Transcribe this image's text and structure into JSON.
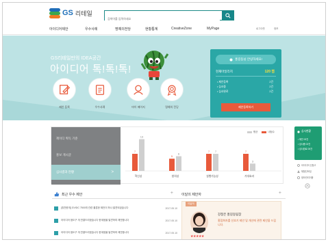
{
  "header": {
    "logo_gs": "GS",
    "logo_text": "리테일",
    "search_placeholder": "검색어를 입력하세요",
    "nav": [
      "아이디어제안",
      "우수사례",
      "명예의전당",
      "현황통계",
      "CreativeZone",
      "MyPage"
    ],
    "util": [
      "로그아웃",
      "정보"
    ]
  },
  "hero": {
    "subtitle": "GS리테일만의 IDEA공간",
    "title": "아이디어 톡!톡!톡!",
    "quick": [
      {
        "label": "제안 등록",
        "icon": "pencil-icon"
      },
      {
        "label": "우수사례",
        "icon": "document-icon"
      },
      {
        "label": "마이 페이지",
        "icon": "person-icon"
      },
      {
        "label": "명예의 전당",
        "icon": "medal-icon"
      }
    ]
  },
  "user_card": {
    "greeting": "홍길동님 안녕하세요!",
    "points_label": "현재마일리지",
    "points_value": "120 점",
    "stats": [
      {
        "label": "• 제안등록",
        "value": "2건"
      },
      {
        "label": "• 심사중",
        "value": "2건"
      },
      {
        "label": "• 심사완료",
        "value": "2건"
      }
    ],
    "button": "제안등록하기"
  },
  "status": {
    "tabs": [
      "제이디 획득 기준",
      "홍보 게시글",
      "심사결과 현황"
    ],
    "active_tab": 2,
    "arrow": ">",
    "legend": [
      {
        "name": "평균",
        "color": "#cfcfcf"
      },
      {
        "name": "내점수",
        "color": "#e85a3b"
      }
    ]
  },
  "chart_data": {
    "type": "bar",
    "categories": [
      "혁신성",
      "창의성",
      "실행가능성",
      "기대효과"
    ],
    "series": [
      {
        "name": "내점수",
        "values": [
          7,
          5,
          7,
          7
        ]
      },
      {
        "name": "평균",
        "values": [
          13,
          6,
          7,
          3
        ]
      }
    ],
    "ylim": [
      0,
      14
    ]
  },
  "side": {
    "title": "심사현황",
    "rows": [
      "• 제안 02건",
      "• 심사중 02건",
      "• 심사완료 00건"
    ],
    "links": [
      "아이디어 신청고",
      "체험단모집",
      "정보관리이용"
    ]
  },
  "best": {
    "title": "최근 우수 제안",
    "more": "+",
    "rows": [
      {
        "text": "[칭찬한개] GVIDC 7500개 관련 홀훈한 제안이 하나 발견되었습니다",
        "date": "2017.05.10"
      },
      {
        "text": "아이디어 점도구 개 연결드리겠습니다 한계점을 발견하여 제안합니다",
        "date": "2017.05.10"
      },
      {
        "text": "아이디어 점도구 개 연결드리겠습니다 한계점을 발견하여 제안합니다",
        "date": "2017.05.10"
      }
    ]
  },
  "monthly": {
    "title": "이달의 제안자",
    "more": "+",
    "label": "이달의",
    "name": "강정은 홍길동팀장",
    "desc": "홍점화자를 선호기 제안 및 개선에 관련 제안을 드립니다.",
    "stars": "★★★★★",
    "star_color": "#e44444"
  },
  "colors": {
    "teal": "#17878a",
    "mint": "#bde3e4",
    "orange": "#e85a3b"
  }
}
